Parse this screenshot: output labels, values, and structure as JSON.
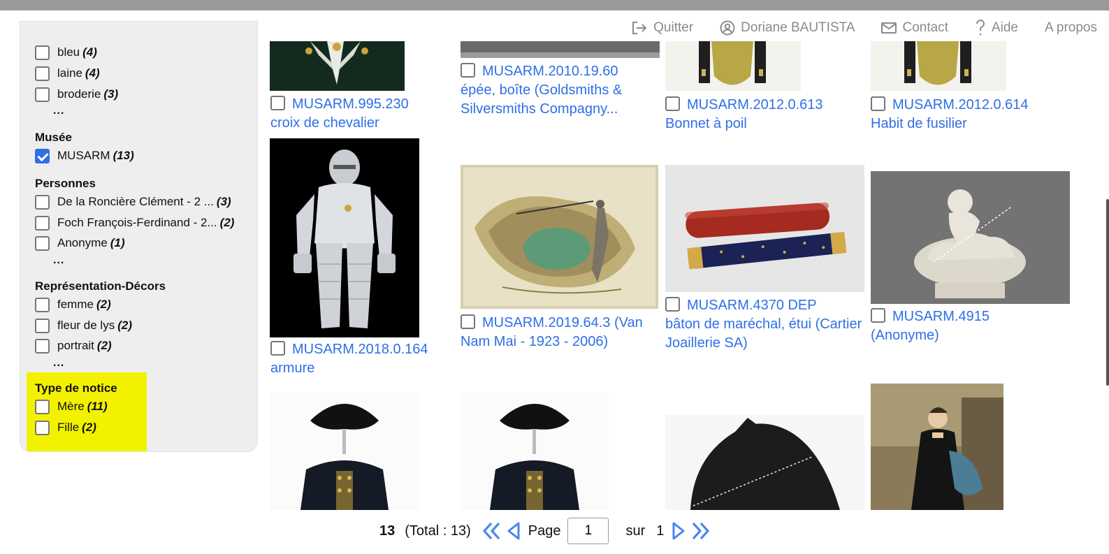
{
  "nav": {
    "quit": "Quitter",
    "user": "Doriane BAUTISTA",
    "contact": "Contact",
    "help": "Aide",
    "about": "A propos"
  },
  "facets": {
    "matiere": [
      {
        "label": "bleu",
        "count": "(4)"
      },
      {
        "label": "laine",
        "count": "(4)"
      },
      {
        "label": "broderie",
        "count": "(3)"
      }
    ],
    "more": "...",
    "musee_title": "Musée",
    "musee": [
      {
        "label": "MUSARM",
        "count": "(13)",
        "checked": true
      }
    ],
    "personnes_title": "Personnes",
    "personnes": [
      {
        "label": "De la Roncière Clément - 2 ...",
        "count": "(3)"
      },
      {
        "label": "Foch François-Ferdinand - 2...",
        "count": "(2)"
      },
      {
        "label": "Anonyme",
        "count": "(1)"
      }
    ],
    "decors_title": "Représentation-Décors",
    "decors": [
      {
        "label": "femme",
        "count": "(2)"
      },
      {
        "label": "fleur de lys",
        "count": "(2)"
      },
      {
        "label": "portrait",
        "count": "(2)"
      }
    ],
    "type_title": "Type de notice",
    "type": [
      {
        "label": "Mère",
        "count": "(11)"
      },
      {
        "label": "Fille",
        "count": "(2)"
      }
    ]
  },
  "results": [
    {
      "id": "MUSARM.995.230",
      "title": "croix de chevalier"
    },
    {
      "id": "MUSARM.2010.19.60",
      "title": "épée, boîte (Goldsmiths & Silversmiths Compagny..."
    },
    {
      "id": "MUSARM.2012.0.613",
      "title": "Bonnet à poil"
    },
    {
      "id": "MUSARM.2012.0.614",
      "title": "Habit de fusilier"
    },
    {
      "id": "MUSARM.2018.0.164",
      "title": "armure"
    },
    {
      "id": "MUSARM.2019.64.3",
      "title": " (Van Nam Mai - 1923 - 2006)"
    },
    {
      "id": "MUSARM.4370 DEP",
      "title": "bâton de maréchal, étui (Cartier Joaillerie SA)"
    },
    {
      "id": "MUSARM.4915",
      "title": "(Anonyme)"
    }
  ],
  "pager": {
    "count": "13",
    "total": "(Total : 13)",
    "page_label": "Page",
    "page_value": "1",
    "of_label": "sur",
    "pages": "1"
  },
  "colors": {
    "link": "#2f6fe6",
    "highlight": "#f2f200",
    "sidebar_bg": "#eeeeee"
  }
}
